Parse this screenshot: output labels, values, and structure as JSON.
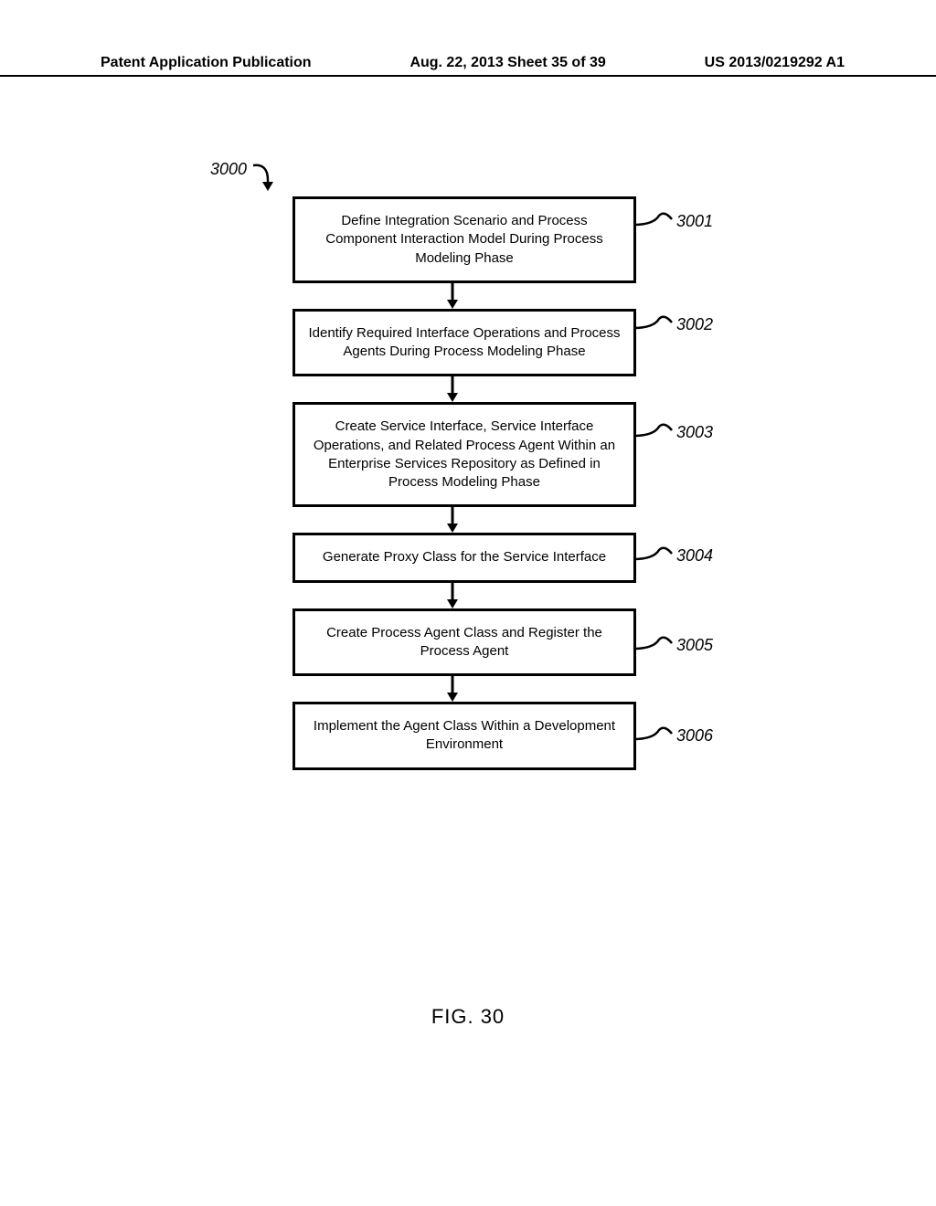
{
  "header": {
    "left": "Patent Application Publication",
    "center": "Aug. 22, 2013  Sheet 35 of 39",
    "right": "US 2013/0219292 A1"
  },
  "diagram_ref": "3000",
  "steps": [
    {
      "ref": "3001",
      "text": "Define Integration Scenario and Process Component Interaction Model During Process Modeling Phase"
    },
    {
      "ref": "3002",
      "text": "Identify Required Interface Operations and Process Agents During Process Modeling Phase"
    },
    {
      "ref": "3003",
      "text": "Create Service Interface, Service Interface Operations, and Related Process Agent Within an Enterprise Services Repository as Defined in Process Modeling Phase"
    },
    {
      "ref": "3004",
      "text": "Generate Proxy Class for the Service Interface"
    },
    {
      "ref": "3005",
      "text": "Create Process Agent Class and Register the Process Agent"
    },
    {
      "ref": "3006",
      "text": "Implement the Agent Class Within a Development Environment"
    }
  ],
  "figure_label": "FIG. 30"
}
